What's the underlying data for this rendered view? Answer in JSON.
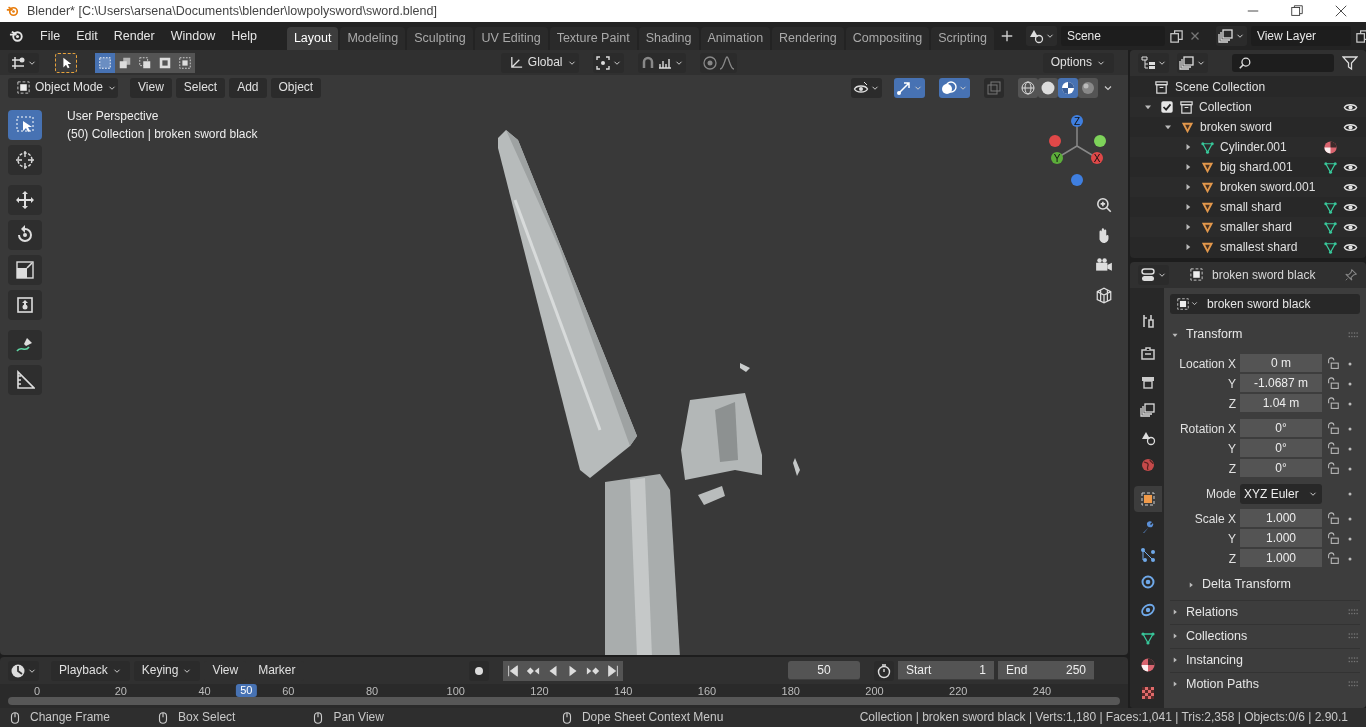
{
  "title_bar": {
    "title": "Blender* [C:\\Users\\arsena\\Documents\\blender\\lowpolysword\\sword.blend]"
  },
  "menu": [
    "File",
    "Edit",
    "Render",
    "Window",
    "Help"
  ],
  "workspaces": [
    {
      "label": "Layout",
      "selected": true
    },
    {
      "label": "Modeling",
      "selected": false
    },
    {
      "label": "Sculpting",
      "selected": false
    },
    {
      "label": "UV Editing",
      "selected": false
    },
    {
      "label": "Texture Paint",
      "selected": false
    },
    {
      "label": "Shading",
      "selected": false
    },
    {
      "label": "Animation",
      "selected": false
    },
    {
      "label": "Rendering",
      "selected": false
    },
    {
      "label": "Compositing",
      "selected": false
    },
    {
      "label": "Scripting",
      "selected": false
    }
  ],
  "scene": {
    "value": "Scene"
  },
  "view_layer": {
    "value": "View Layer"
  },
  "tool_header": {
    "select_modes": [
      {
        "selected": true
      },
      {
        "selected": false
      },
      {
        "selected": false
      },
      {
        "selected": false
      },
      {
        "selected": false
      }
    ],
    "orientation": "Global",
    "options": "Options"
  },
  "viewport_header": {
    "mode": "Object Mode",
    "menus": [
      "View",
      "Select",
      "Add",
      "Object"
    ],
    "toggles": [
      {
        "kind": "gizmos",
        "on": true
      },
      {
        "kind": "overlays",
        "on": true
      },
      {
        "kind": "xray",
        "on": false
      }
    ],
    "shading_modes": [
      {
        "kind": "wireframe",
        "selected": false
      },
      {
        "kind": "solid",
        "selected": false
      },
      {
        "kind": "material",
        "selected": true
      },
      {
        "kind": "rendered",
        "selected": false
      }
    ]
  },
  "toolbar": [
    {
      "kind": "select",
      "selected": true
    },
    {
      "kind": "cursor",
      "selected": false
    },
    {
      "kind": "move",
      "selected": false
    },
    {
      "kind": "rotate",
      "selected": false
    },
    {
      "kind": "scale",
      "selected": false
    },
    {
      "kind": "transform",
      "selected": false
    },
    {
      "kind": "annotate",
      "selected": false
    },
    {
      "kind": "measure",
      "selected": false
    }
  ],
  "viewport": {
    "perspective": "User Perspective",
    "info": "(50) Collection | broken sword black",
    "gizmo_axes": [
      "Z",
      "Y",
      "X"
    ]
  },
  "timeline": {
    "menus": [
      {
        "label": "Playback",
        "dropdown": true
      },
      {
        "label": "Keying",
        "dropdown": true
      },
      {
        "label": "View",
        "dropdown": false
      },
      {
        "label": "Marker",
        "dropdown": false
      }
    ],
    "current_frame": "50",
    "start_label": "Start",
    "start": "1",
    "end_label": "End",
    "end": "250",
    "ticks": [
      "0",
      "20",
      "40",
      "60",
      "80",
      "100",
      "120",
      "140",
      "160",
      "180",
      "200",
      "220",
      "240"
    ],
    "playhead": {
      "label": "50",
      "level": 0.2
    }
  },
  "status_bar": {
    "hints": [
      "Change Frame",
      "Box Select",
      "Pan View",
      "Dope Sheet Context Menu"
    ],
    "stats": "Collection | broken sword black | Verts:1,180 | Faces:1,041 | Tris:2,358 | Objects:0/6 | 2.90.1"
  },
  "outliner": {
    "root": "Scene Collection",
    "tree": [
      {
        "label": "Collection",
        "kind": "collection",
        "checked": true,
        "expanded": true,
        "visible": true,
        "children": [
          {
            "label": "broken sword",
            "kind": "object",
            "expanded": true,
            "visible": true,
            "children": [
              {
                "label": "Cylinder.001",
                "kind": "mesh",
                "expanded": false,
                "visible": false,
                "badge": {
                  "kind": "material"
                }
              },
              {
                "label": "big shard.001",
                "kind": "object",
                "expanded": false,
                "visible": true,
                "badge": {
                  "kind": "mesh"
                }
              },
              {
                "label": "broken sword.001",
                "kind": "object",
                "expanded": false,
                "visible": true
              },
              {
                "label": "small shard",
                "kind": "object",
                "expanded": false,
                "visible": true,
                "badge": {
                  "kind": "mesh"
                }
              },
              {
                "label": "smaller shard",
                "kind": "object",
                "expanded": false,
                "visible": true,
                "badge": {
                  "kind": "mesh"
                }
              },
              {
                "label": "smallest shard",
                "kind": "object",
                "expanded": false,
                "visible": true,
                "badge": {
                  "kind": "mesh"
                }
              }
            ]
          }
        ]
      }
    ]
  },
  "properties": {
    "header_name": "broken sword black",
    "object_name": "broken sword black",
    "tabs": [
      {
        "kind": "tool",
        "selected": false
      },
      {
        "kind": "render",
        "selected": false
      },
      {
        "kind": "output",
        "selected": false
      },
      {
        "kind": "view_layer",
        "selected": false
      },
      {
        "kind": "scene",
        "selected": false
      },
      {
        "kind": "world",
        "selected": false
      },
      {
        "kind": "object",
        "selected": true
      },
      {
        "kind": "modifiers",
        "selected": false
      },
      {
        "kind": "particles",
        "selected": false
      },
      {
        "kind": "physics",
        "selected": false
      },
      {
        "kind": "constraints",
        "selected": false
      },
      {
        "kind": "data",
        "selected": false
      },
      {
        "kind": "material",
        "selected": false
      },
      {
        "kind": "texture",
        "selected": false
      }
    ],
    "transform": {
      "title": "Transform",
      "expanded": true,
      "groups": [
        {
          "rows": [
            {
              "kind": "number",
              "label": "Location X",
              "value": "0 m"
            },
            {
              "kind": "number",
              "label": "Y",
              "value": "-1.0687 m"
            },
            {
              "kind": "number",
              "label": "Z",
              "value": "1.04 m"
            }
          ]
        },
        {
          "rows": [
            {
              "kind": "number",
              "label": "Rotation X",
              "value": "0°"
            },
            {
              "kind": "number",
              "label": "Y",
              "value": "0°"
            },
            {
              "kind": "number",
              "label": "Z",
              "value": "0°"
            }
          ]
        },
        {
          "rows": [
            {
              "kind": "dropdown",
              "label": "Mode",
              "value": "XYZ Euler"
            }
          ]
        },
        {
          "rows": [
            {
              "kind": "number",
              "label": "Scale X",
              "value": "1.000"
            },
            {
              "kind": "number",
              "label": "Y",
              "value": "1.000"
            },
            {
              "kind": "number",
              "label": "Z",
              "value": "1.000"
            }
          ]
        }
      ],
      "subpanel": {
        "label": "Delta Transform",
        "expanded": false
      }
    },
    "panels": [
      {
        "label": "Relations",
        "expanded": false
      },
      {
        "label": "Collections",
        "expanded": false
      },
      {
        "label": "Instancing",
        "expanded": false
      },
      {
        "label": "Motion Paths",
        "expanded": false
      }
    ]
  }
}
